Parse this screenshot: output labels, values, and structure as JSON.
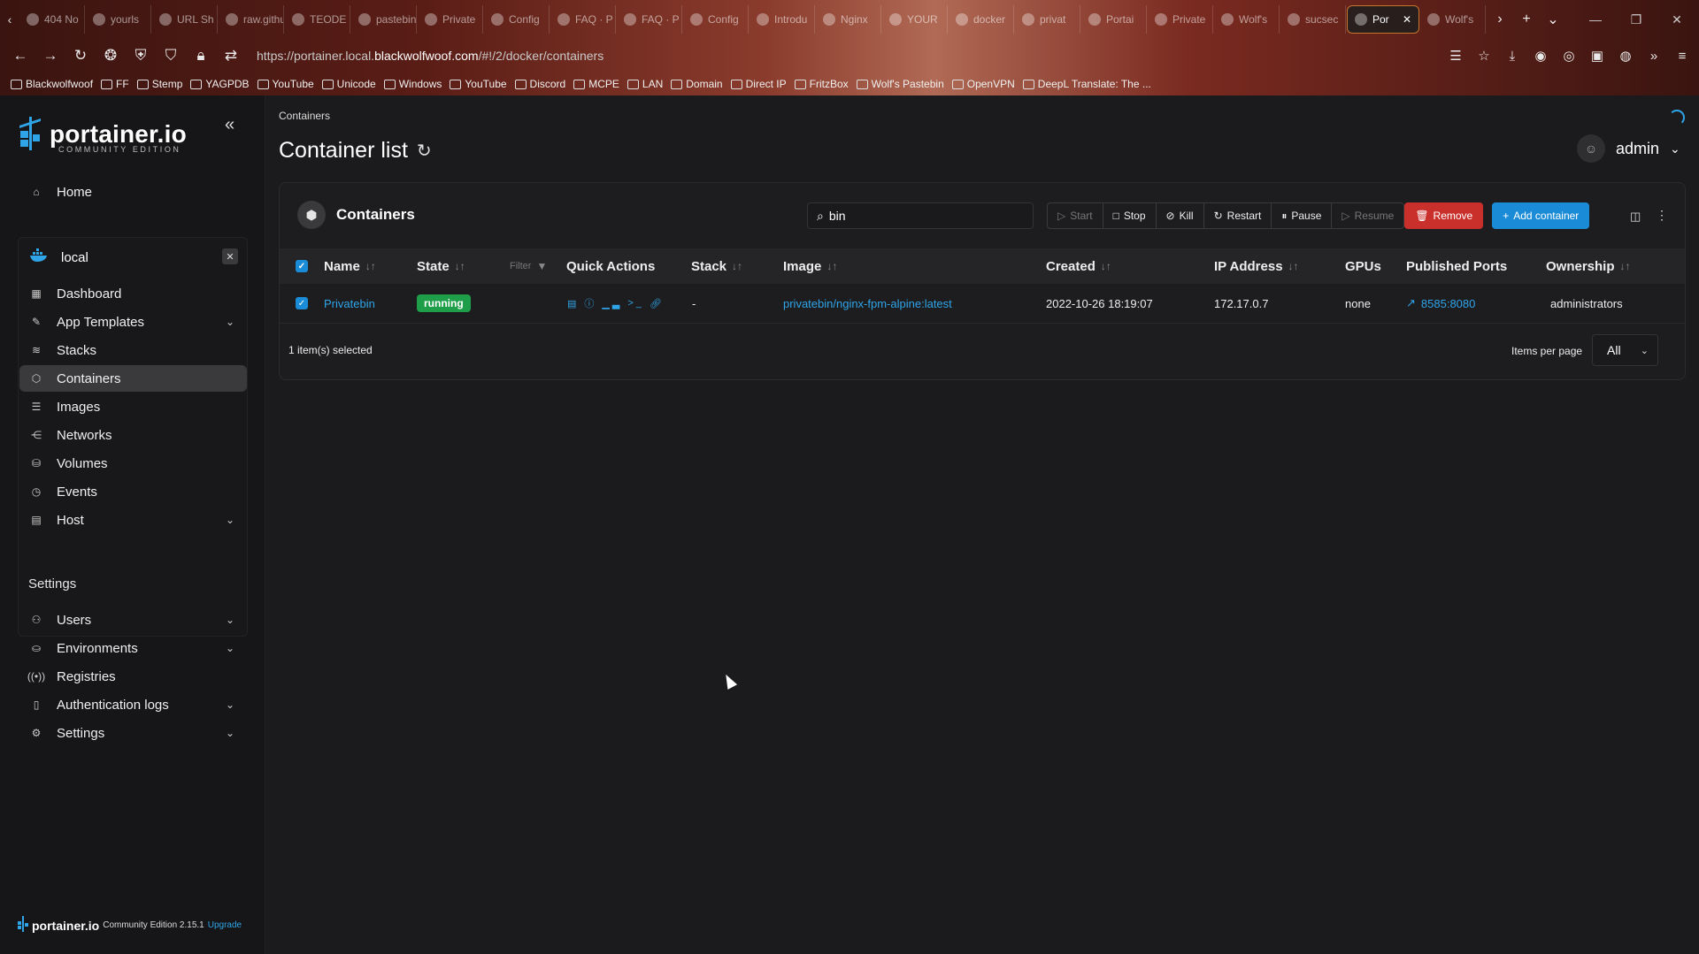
{
  "browser": {
    "tabs": [
      {
        "label": "404 No"
      },
      {
        "label": "yourls"
      },
      {
        "label": "URL Sh"
      },
      {
        "label": "raw.githu"
      },
      {
        "label": "TEODE"
      },
      {
        "label": "pastebin.b"
      },
      {
        "label": "Private"
      },
      {
        "label": "Config"
      },
      {
        "label": "FAQ · P"
      },
      {
        "label": "FAQ · P"
      },
      {
        "label": "Config"
      },
      {
        "label": "Introdu"
      },
      {
        "label": "Nginx"
      },
      {
        "label": "YOUR"
      },
      {
        "label": "docker"
      },
      {
        "label": "privat"
      },
      {
        "label": "Portai"
      },
      {
        "label": "Private"
      },
      {
        "label": "Wolf's"
      },
      {
        "label": "sucsec"
      },
      {
        "label": "Por"
      },
      {
        "label": "Wolf's"
      }
    ],
    "url_prefix": "https://portainer.local.",
    "url_host": "blackwolfwoof.com",
    "url_path": "/#!/2/docker/containers",
    "bookmarks": [
      "Blackwolfwoof",
      "FF",
      "Stemp",
      "YAGPDB",
      "YouTube",
      "Unicode",
      "Windows",
      "YouTube",
      "Discord",
      "MCPE",
      "LAN",
      "Domain",
      "Direct IP",
      "FritzBox",
      "Wolf's Pastebin",
      "OpenVPN",
      "DeepL Translate: The ..."
    ]
  },
  "sidebar": {
    "logo_text": "portainer.io",
    "logo_sub": "COMMUNITY EDITION",
    "home": "Home",
    "environment": "local",
    "env_items": [
      "Dashboard",
      "App Templates",
      "Stacks",
      "Containers",
      "Images",
      "Networks",
      "Volumes",
      "Events",
      "Host"
    ],
    "settings_heading": "Settings",
    "settings_items": [
      "Users",
      "Environments",
      "Registries",
      "Authentication logs",
      "Settings"
    ],
    "footer_brand": "portainer.io",
    "footer_edition": "Community Edition 2.15.1",
    "footer_upgrade": "Upgrade"
  },
  "header": {
    "breadcrumb": "Containers",
    "title": "Container list",
    "user": "admin"
  },
  "panel": {
    "title": "Containers",
    "search_value": "bin",
    "actions": [
      "Start",
      "Stop",
      "Kill",
      "Restart",
      "Pause",
      "Resume",
      "Remove"
    ],
    "add_label": "Add container",
    "columns": [
      "Name",
      "State",
      "Filter",
      "Quick Actions",
      "Stack",
      "Image",
      "Created",
      "IP Address",
      "GPUs",
      "Published Ports",
      "Ownership"
    ],
    "rows": [
      {
        "name": "Privatebin",
        "state": "running",
        "stack": "-",
        "image": "privatebin/nginx-fpm-alpine:latest",
        "created": "2022-10-26 18:19:07",
        "ip": "172.17.0.7",
        "gpus": "none",
        "ports": "8585:8080",
        "ownership": "administrators"
      }
    ],
    "selected_text": "1 item(s) selected",
    "items_per_page_label": "Items per page",
    "items_per_page_value": "All"
  },
  "colors": {
    "accent": "#1a8bd6",
    "link": "#2fa4e7",
    "running": "#1e9e49",
    "danger": "#c9302c"
  }
}
